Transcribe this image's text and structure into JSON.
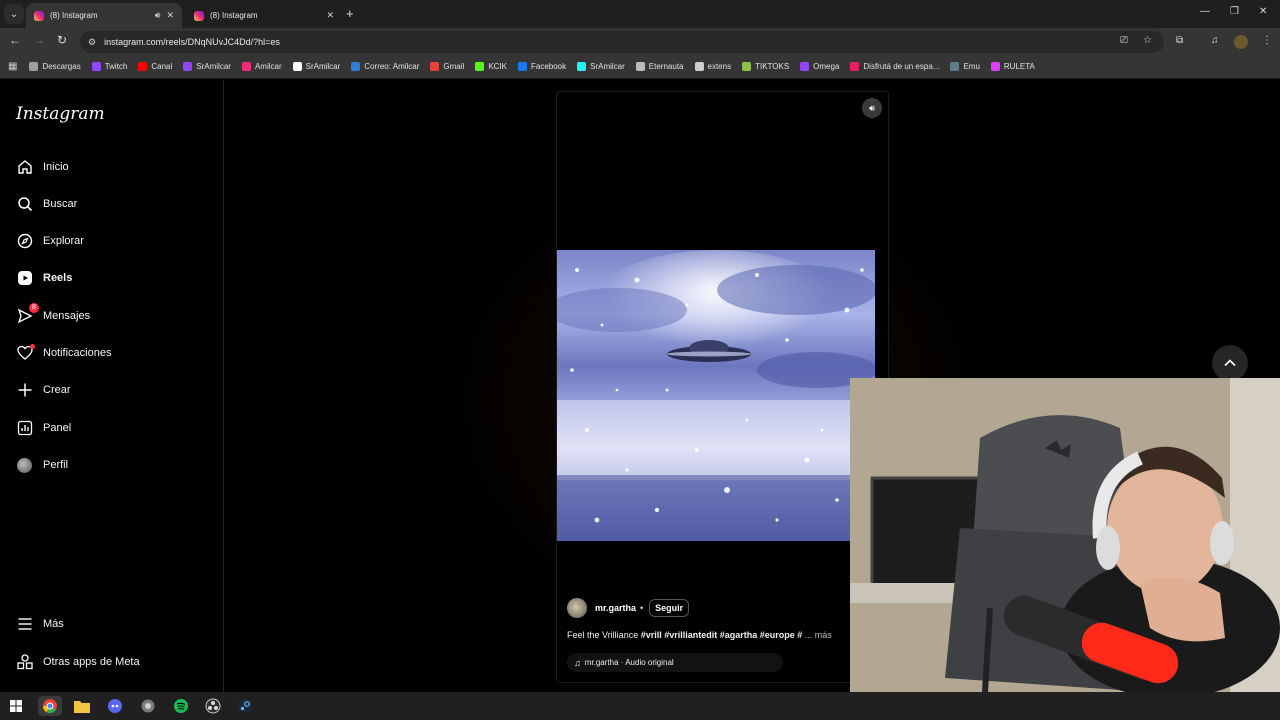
{
  "browser": {
    "tabs": [
      {
        "title": "(8) Instagram",
        "active": true
      },
      {
        "title": "(8) Instagram",
        "active": false
      }
    ],
    "url": "instagram.com/reels/DNqNUvJC4Dd/?hl=es",
    "bookmarks": [
      {
        "label": "Descargas",
        "color": "#9e9e9e"
      },
      {
        "label": "Twitch",
        "color": "#9146ff"
      },
      {
        "label": "Canal",
        "color": "#ff0000"
      },
      {
        "label": "SrAmilcar",
        "color": "#9146ff"
      },
      {
        "label": "Amilcar",
        "color": "#ee2a7b"
      },
      {
        "label": "SrAmilcar",
        "color": "#ffffff"
      },
      {
        "label": "Correo: Amilcar",
        "color": "#2f7bd6"
      },
      {
        "label": "Gmail",
        "color": "#ea4335"
      },
      {
        "label": "KCIK",
        "color": "#53fc18"
      },
      {
        "label": "Facebook",
        "color": "#1877f2"
      },
      {
        "label": "SrAmilcar",
        "color": "#25f4ee"
      },
      {
        "label": "Eternauta",
        "color": "#bbbbbb"
      },
      {
        "label": "extens",
        "color": "#cfcfcf"
      },
      {
        "label": "TIKTOKS",
        "color": "#8bc34a"
      },
      {
        "label": "Omega",
        "color": "#9146ff"
      },
      {
        "label": "Disfrutá de un espa...",
        "color": "#e91e63"
      },
      {
        "label": "Emu",
        "color": "#607d8b"
      },
      {
        "label": "RULETA",
        "color": "#e040fb"
      }
    ]
  },
  "sidebar": {
    "logo": "Instagram",
    "items": [
      {
        "label": "Inicio",
        "icon": "home-icon"
      },
      {
        "label": "Buscar",
        "icon": "search-icon"
      },
      {
        "label": "Explorar",
        "icon": "compass-icon"
      },
      {
        "label": "Reels",
        "icon": "reels-icon"
      },
      {
        "label": "Mensajes",
        "icon": "messenger-icon",
        "badge": "8"
      },
      {
        "label": "Notificaciones",
        "icon": "heart-icon"
      },
      {
        "label": "Crear",
        "icon": "plus-icon"
      },
      {
        "label": "Panel",
        "icon": "chart-icon"
      },
      {
        "label": "Perfil",
        "icon": "avatar"
      }
    ],
    "more": "Más",
    "meta_apps": "Otras apps de Meta"
  },
  "reel": {
    "author": "mr.gartha",
    "separator": "•",
    "follow": "Seguir",
    "caption_text": "Feel the Vrilliance ",
    "caption_tags": "#vrill #vrilliantedit #agartha #europe #",
    "caption_more": "... más",
    "audio": "mr.gartha · Audio original"
  }
}
